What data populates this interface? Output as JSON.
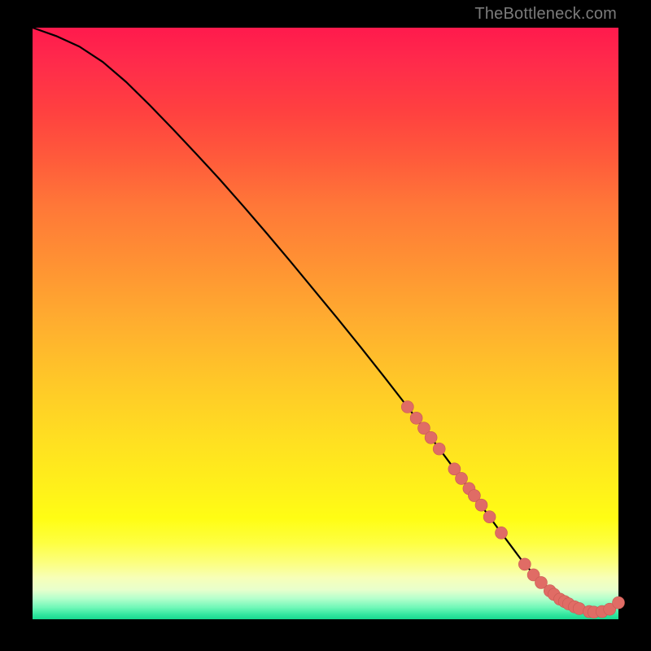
{
  "watermark": "TheBottleneck.com",
  "colors": {
    "curve": "#000000",
    "marker_fill": "#e06c65",
    "marker_stroke": "#c85a54",
    "background": "#000000"
  },
  "chart_data": {
    "type": "line",
    "title": "",
    "xlabel": "",
    "ylabel": "",
    "xlim": [
      0,
      100
    ],
    "ylim": [
      0,
      100
    ],
    "grid": false,
    "legend": false,
    "series": [
      {
        "name": "curve",
        "x": [
          0,
          4,
          8,
          12,
          16,
          20,
          24,
          28,
          32,
          36,
          40,
          44,
          48,
          52,
          56,
          60,
          64,
          68,
          72,
          76,
          80,
          84,
          88,
          92,
          94,
          96,
          98,
          100
        ],
        "y": [
          100,
          98.6,
          96.8,
          94.2,
          90.8,
          86.9,
          82.8,
          78.6,
          74.3,
          69.8,
          65.2,
          60.5,
          55.7,
          50.9,
          46.0,
          41.0,
          35.9,
          30.7,
          25.4,
          20.0,
          14.6,
          9.3,
          5.0,
          2.3,
          1.6,
          1.2,
          1.5,
          2.8
        ]
      }
    ],
    "markers": [
      {
        "x": 64.0,
        "y": 35.9
      },
      {
        "x": 65.5,
        "y": 34.0
      },
      {
        "x": 66.8,
        "y": 32.3
      },
      {
        "x": 68.0,
        "y": 30.7
      },
      {
        "x": 69.4,
        "y": 28.8
      },
      {
        "x": 72.0,
        "y": 25.4
      },
      {
        "x": 73.2,
        "y": 23.8
      },
      {
        "x": 74.5,
        "y": 22.1
      },
      {
        "x": 75.4,
        "y": 20.9
      },
      {
        "x": 76.6,
        "y": 19.3
      },
      {
        "x": 78.0,
        "y": 17.3
      },
      {
        "x": 80.0,
        "y": 14.6
      },
      {
        "x": 84.0,
        "y": 9.3
      },
      {
        "x": 85.5,
        "y": 7.5
      },
      {
        "x": 86.8,
        "y": 6.2
      },
      {
        "x": 88.3,
        "y": 4.8
      },
      {
        "x": 89.0,
        "y": 4.2
      },
      {
        "x": 90.0,
        "y": 3.4
      },
      {
        "x": 90.8,
        "y": 3.0
      },
      {
        "x": 91.5,
        "y": 2.6
      },
      {
        "x": 92.5,
        "y": 2.1
      },
      {
        "x": 93.3,
        "y": 1.8
      },
      {
        "x": 95.0,
        "y": 1.3
      },
      {
        "x": 95.8,
        "y": 1.2
      },
      {
        "x": 97.2,
        "y": 1.3
      },
      {
        "x": 98.5,
        "y": 1.7
      },
      {
        "x": 100.0,
        "y": 2.8
      }
    ]
  }
}
